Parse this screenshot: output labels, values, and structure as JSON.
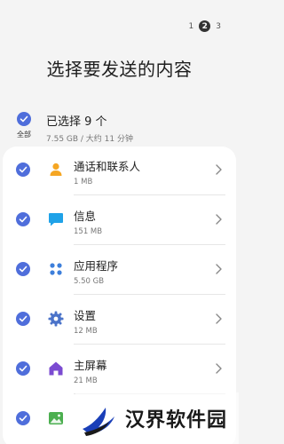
{
  "pager": {
    "pages": [
      "1",
      "2",
      "3"
    ],
    "active_index": 1
  },
  "title": "选择要发送的内容",
  "summary": {
    "all_label": "全部",
    "selected_text": "已选择 9 个",
    "size_time": "7.55 GB / 大约 11 分钟"
  },
  "items": [
    {
      "name": "通话和联系人",
      "size": "1 MB",
      "icon": "contacts-icon",
      "color": "#f5a623"
    },
    {
      "name": "信息",
      "size": "151 MB",
      "icon": "message-icon",
      "color": "#1fa2e8"
    },
    {
      "name": "应用程序",
      "size": "5.50 GB",
      "icon": "apps-icon",
      "color": "#3d7fdb"
    },
    {
      "name": "设置",
      "size": "12 MB",
      "icon": "settings-icon",
      "color": "#4b73c9"
    },
    {
      "name": "主屏幕",
      "size": "21 MB",
      "icon": "home-icon",
      "color": "#7b4bd1"
    },
    {
      "name": "",
      "size": "",
      "icon": "image-icon",
      "color": "#4caf50"
    }
  ],
  "watermark": {
    "text": "汉界软件园"
  },
  "colors": {
    "accent": "#4f6edb",
    "background": "#f4f4f4",
    "card": "#ffffff"
  }
}
